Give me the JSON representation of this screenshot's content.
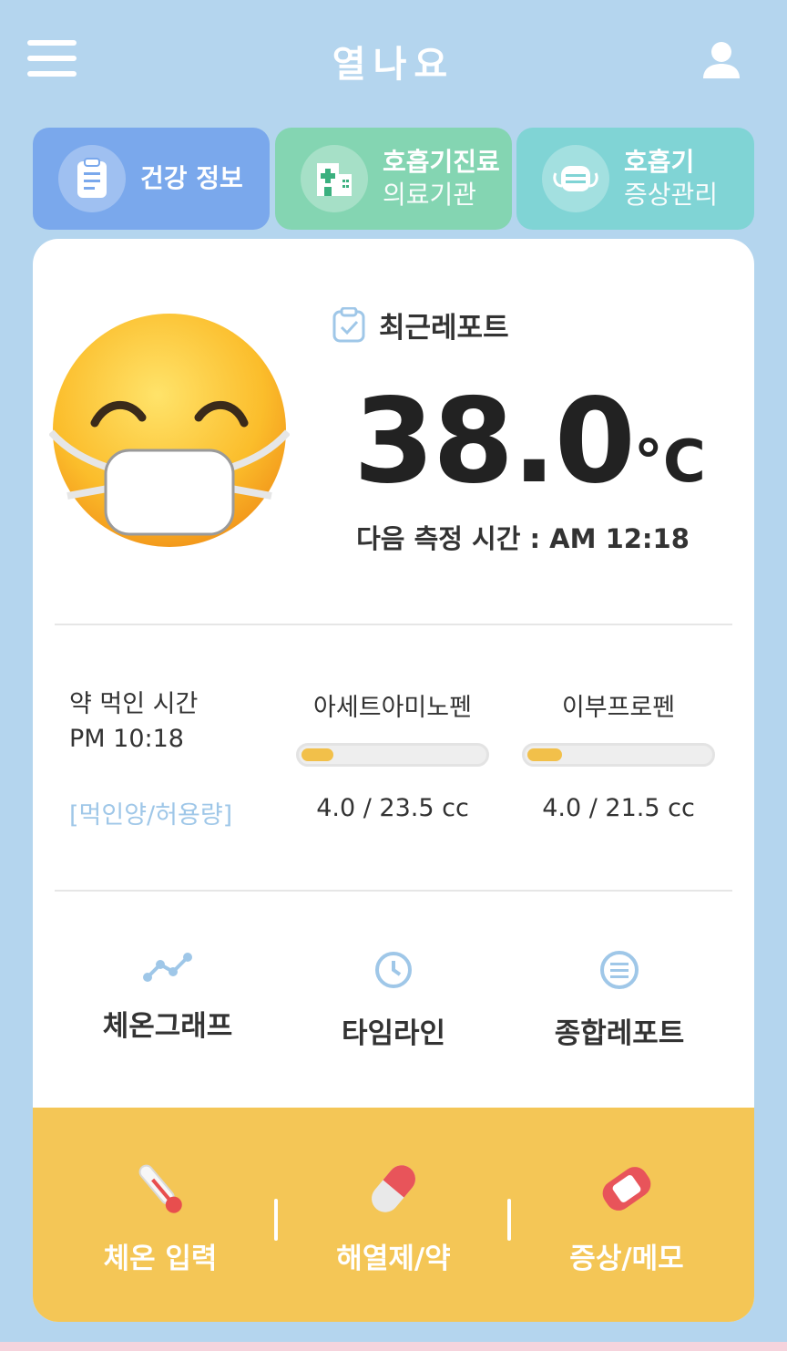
{
  "header": {
    "title": "열나요",
    "menu_icon": "hamburger-menu-icon",
    "profile_icon": "user-profile-icon"
  },
  "tabs": [
    {
      "label": "건강 정보",
      "sub": "",
      "icon": "clipboard-icon",
      "color": "#7aa8ec"
    },
    {
      "label": "호흡기진료",
      "sub": "의료기관",
      "icon": "hospital-icon",
      "color": "#84d5b2"
    },
    {
      "label": "호흡기",
      "sub": "증상관리",
      "icon": "mask-icon",
      "color": "#80d4d5"
    }
  ],
  "report": {
    "label": "최근레포트",
    "temperature": "38.0",
    "unit": "°C",
    "next_measure": "다음 측정 시간 : AM 12:18"
  },
  "medication": {
    "label_line1": "약 먹인 시간",
    "label_line2": "PM 10:18",
    "ratio_label": "[먹인양/허용량]",
    "items": [
      {
        "name": "아세트아미노펜",
        "amount": "4.0 / 23.5 cc",
        "taken": 4.0,
        "limit": 23.5
      },
      {
        "name": "이부프로펜",
        "amount": "4.0 / 21.5 cc",
        "taken": 4.0,
        "limit": 21.5
      }
    ]
  },
  "shortcuts": [
    {
      "label": "체온그래프",
      "icon": "line-graph-icon"
    },
    {
      "label": "타임라인",
      "icon": "clock-icon"
    },
    {
      "label": "종합레포트",
      "icon": "list-icon"
    }
  ],
  "bottom_actions": [
    {
      "label": "체온 입력",
      "icon": "thermometer-icon"
    },
    {
      "label": "해열제/약",
      "icon": "pill-capsule-icon"
    },
    {
      "label": "증상/메모",
      "icon": "bandage-icon"
    }
  ],
  "colors": {
    "background": "#b4d5ee",
    "accent_yellow": "#f4c656",
    "icon_blue": "#9fc7e8"
  }
}
